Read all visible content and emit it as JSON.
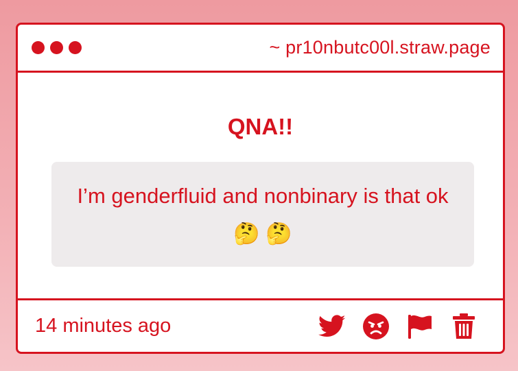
{
  "window": {
    "site": "~ pr10nbutc00l.straw.page"
  },
  "post": {
    "heading": "QNA!!",
    "question": "I’m genderfluid and nonbinary is that ok🤔 🤔"
  },
  "footer": {
    "timestamp": "14 minutes ago",
    "actions": [
      "twitter-icon",
      "angry-face-icon",
      "flag-icon",
      "trash-icon"
    ]
  },
  "colors": {
    "accent": "#d6131f",
    "background": "#f3b1b6",
    "question_bg": "#eeebec"
  }
}
